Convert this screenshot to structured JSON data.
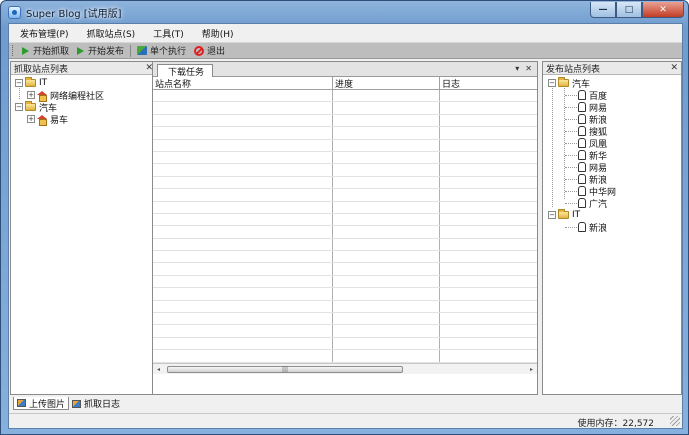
{
  "window": {
    "title": "Super Blog [试用版]",
    "controls": {
      "minimize": "—",
      "maximize": "□",
      "close": "✕"
    }
  },
  "menu": [
    "发布管理(P)",
    "抓取站点(S)",
    "工具(T)",
    "帮助(H)"
  ],
  "toolbar": {
    "start_crawl": "开始抓取",
    "start_publish": "开始发布",
    "single_exec": "单个执行",
    "exit": "退出"
  },
  "left_panel": {
    "title": "抓取站点列表",
    "close": "✕",
    "tree": [
      {
        "label": "IT",
        "children": [
          {
            "label": "网络编程社区"
          }
        ]
      },
      {
        "label": "汽车",
        "children": [
          {
            "label": "易车"
          }
        ]
      }
    ]
  },
  "center": {
    "tab": "下载任务",
    "tab_controls": [
      "▾",
      "✕"
    ],
    "columns": [
      "站点名称",
      "进度",
      "日志"
    ],
    "scroll": {
      "left": "◂",
      "right": "▸",
      "grip": "|||"
    }
  },
  "right_panel": {
    "title": "发布站点列表",
    "close": "✕",
    "tree": [
      {
        "label": "汽车",
        "children": [
          "百度",
          "网易",
          "新浪",
          "搜狐",
          "凤凰",
          "新华",
          "网易",
          "新浪",
          "中华网",
          "广汽"
        ]
      },
      {
        "label": "IT",
        "children": [
          "新浪"
        ]
      }
    ]
  },
  "bottom_tabs": [
    "上传图片",
    "抓取日志"
  ],
  "status": {
    "memory": "使用内存：22,572"
  },
  "colors": {
    "title_gradient": "#6f9ccf",
    "close_button": "#c23d24",
    "toolbar_bg": "#bdbdbd"
  }
}
